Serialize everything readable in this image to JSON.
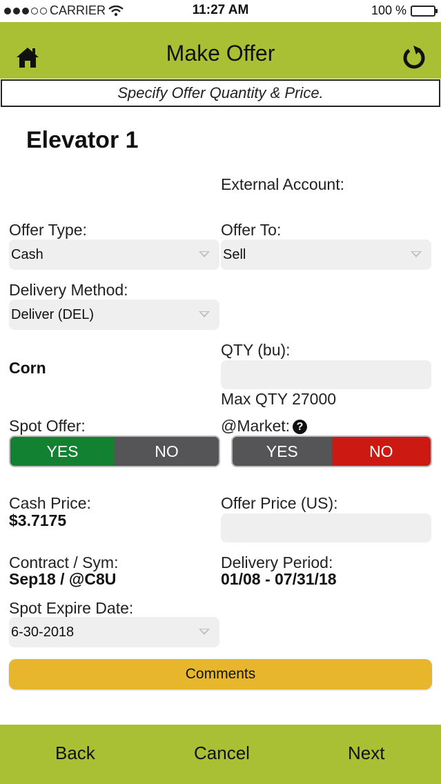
{
  "status_bar": {
    "carrier": "CARRIER",
    "time": "11:27 AM",
    "battery": "100 %"
  },
  "header": {
    "title": "Make Offer",
    "home_icon": "home-icon",
    "refresh_icon": "refresh-icon"
  },
  "instruction": "Specify Offer Quantity & Price.",
  "page_title": "Elevator 1",
  "external_account": {
    "label": "External Account:"
  },
  "offer_type": {
    "label": "Offer Type:",
    "value": "Cash"
  },
  "offer_to": {
    "label": "Offer To:",
    "value": "Sell"
  },
  "delivery_method": {
    "label": "Delivery Method:",
    "value": "Deliver (DEL)"
  },
  "commodity": "Corn",
  "qty": {
    "label": "QTY (bu):",
    "value": "",
    "max_text": "Max QTY 27000"
  },
  "spot_offer": {
    "label": "Spot Offer:",
    "yes": "YES",
    "no": "NO",
    "selected": "YES"
  },
  "at_market": {
    "label": "@Market:",
    "yes": "YES",
    "no": "NO",
    "selected": "NO"
  },
  "cash_price": {
    "label": "Cash Price:",
    "value": "$3.7175"
  },
  "offer_price": {
    "label": "Offer Price (US):",
    "value": ""
  },
  "contract": {
    "label": "Contract / Sym:",
    "value": "Sep18 / @C8U"
  },
  "delivery_period": {
    "label": "Delivery Period:",
    "value": "01/08 - 07/31/18"
  },
  "spot_expire": {
    "label": "Spot Expire Date:",
    "value": "6-30-2018"
  },
  "comments_label": "Comments",
  "footer": {
    "back": "Back",
    "cancel": "Cancel",
    "next": "Next"
  },
  "colors": {
    "header_bg": "#a9c035",
    "yes_active": "#128132",
    "no_active": "#cc1a12",
    "toggle_inactive": "#555557",
    "comments_bg": "#e8b62c"
  }
}
